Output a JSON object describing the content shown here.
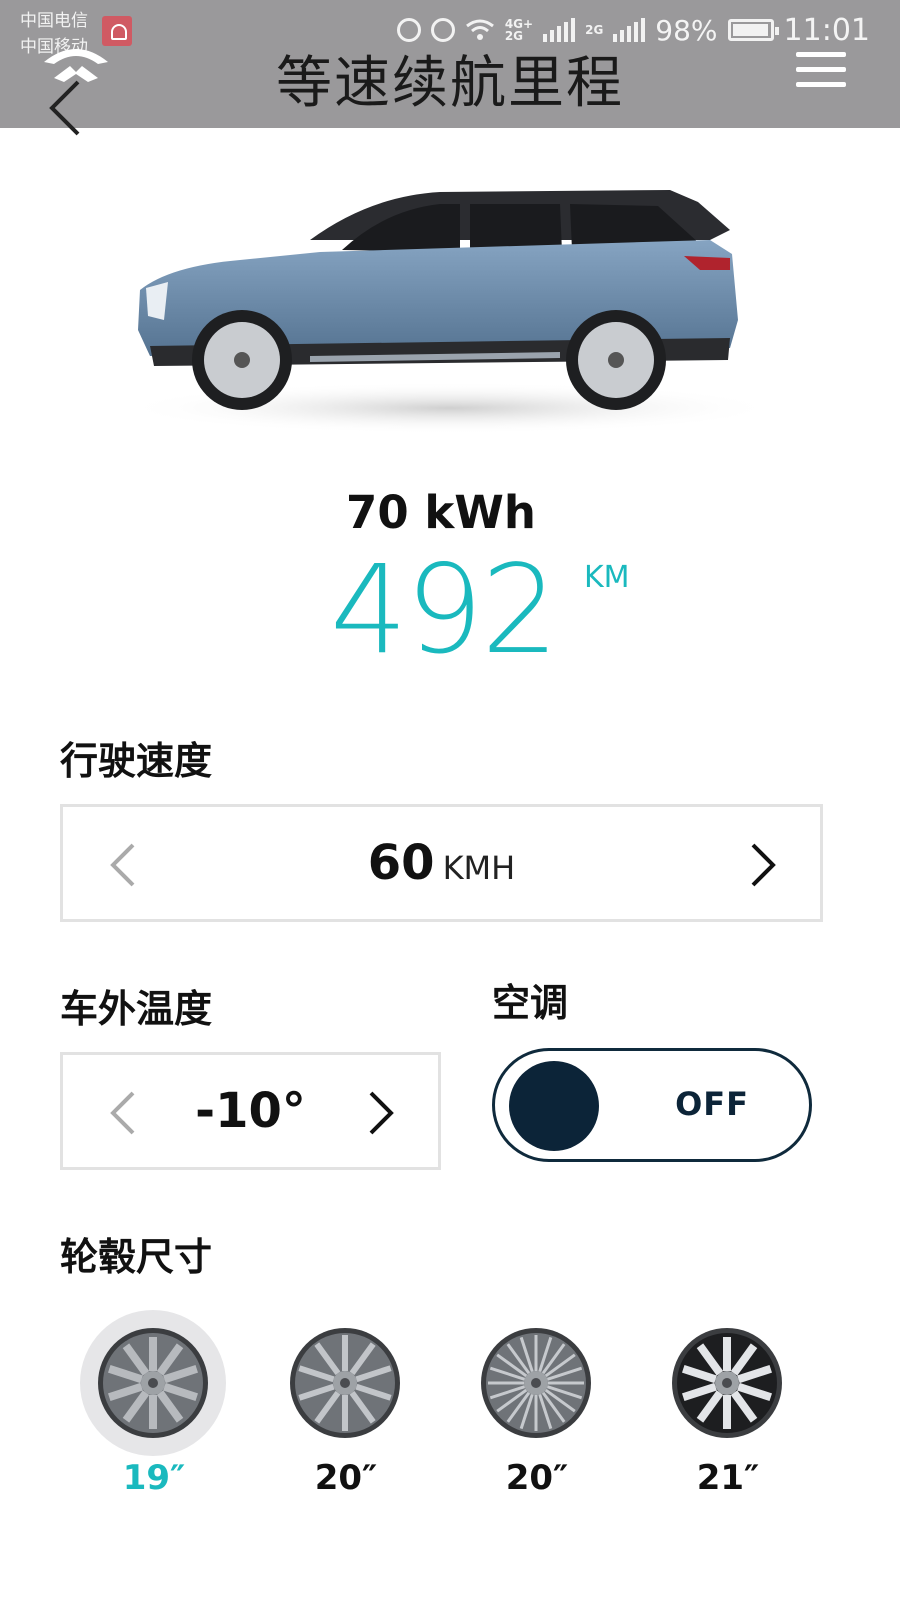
{
  "status_bar": {
    "carrier_1": "中国电信",
    "carrier_2": "中国移动",
    "network_1": "4G+",
    "network_2": "2G",
    "network_3": "2G",
    "battery_percent": "98%",
    "time": "11:01"
  },
  "header": {
    "title": "等速续航里程"
  },
  "range": {
    "battery_capacity": "70 kWh",
    "value": "492",
    "unit": "KM"
  },
  "speed": {
    "label": "行驶速度",
    "value": "60",
    "unit": "KMH"
  },
  "temperature": {
    "label": "车外温度",
    "value": "-10°"
  },
  "ac": {
    "label": "空调",
    "state": "OFF"
  },
  "wheels": {
    "label": "轮毂尺寸",
    "options": [
      {
        "size": "19″",
        "selected": true
      },
      {
        "size": "20″",
        "selected": false
      },
      {
        "size": "20″",
        "selected": false
      },
      {
        "size": "21″",
        "selected": false
      }
    ]
  },
  "colors": {
    "accent": "#1ab9be",
    "header_bg": "#9a999b",
    "toggle_dark": "#0c2438",
    "car_body": "#6f8fb0"
  }
}
